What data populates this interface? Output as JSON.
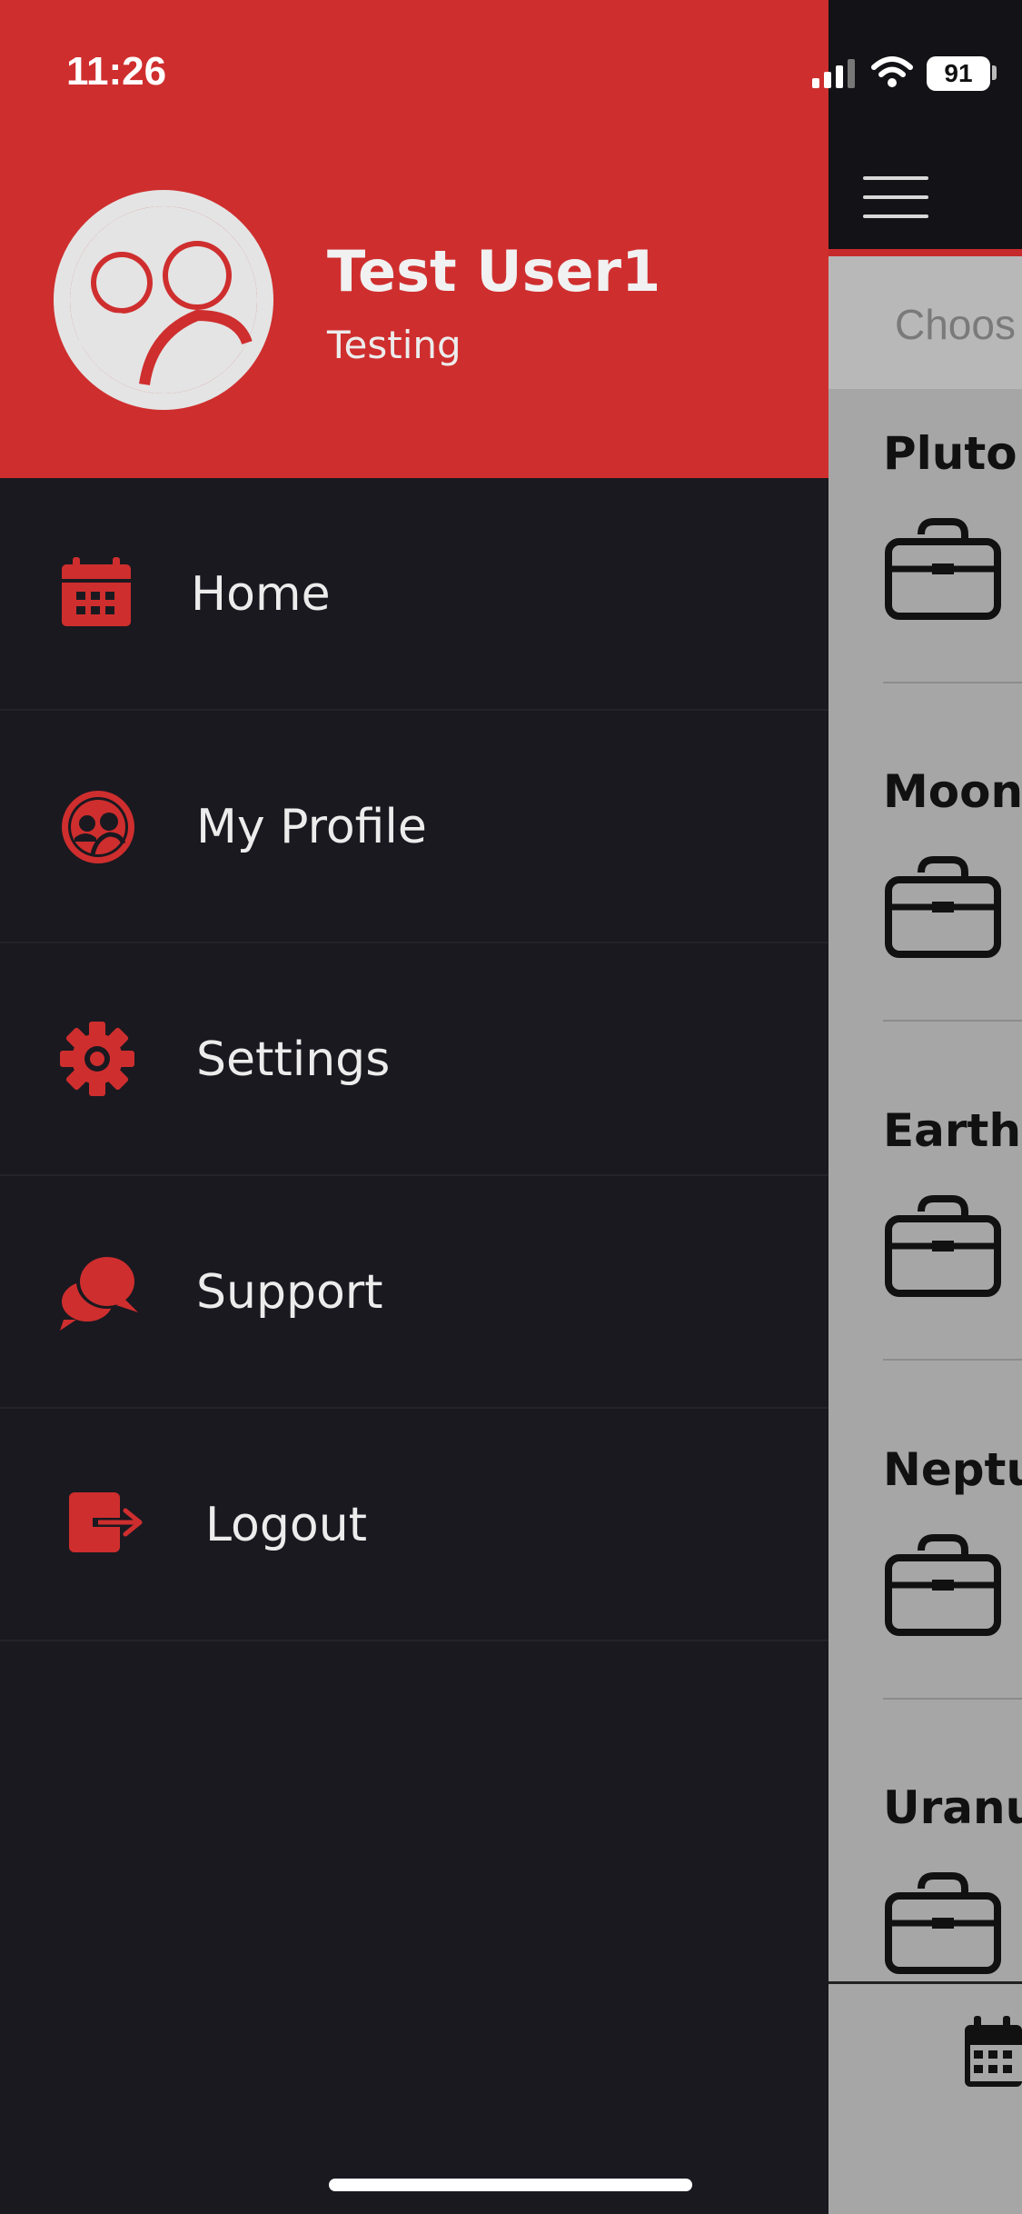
{
  "status_bar": {
    "time": "11:26",
    "battery": "91"
  },
  "drawer": {
    "user": {
      "name": "Test User1",
      "role": "Testing"
    },
    "menu": [
      {
        "label": "Home",
        "icon": "calendar-icon"
      },
      {
        "label": "My Profile",
        "icon": "profile-icon"
      },
      {
        "label": "Settings",
        "icon": "gear-icon"
      },
      {
        "label": "Support",
        "icon": "chat-bubbles-icon"
      },
      {
        "label": "Logout",
        "icon": "logout-icon"
      }
    ]
  },
  "background_screen": {
    "chooser_placeholder": "Choos",
    "planets": [
      "Pluto",
      "Moon",
      "Earth",
      "Neptu",
      "Uranu"
    ]
  },
  "colors": {
    "accent": "#cf2e2e",
    "drawer_bg": "#1a1920",
    "text": "#ececec"
  }
}
